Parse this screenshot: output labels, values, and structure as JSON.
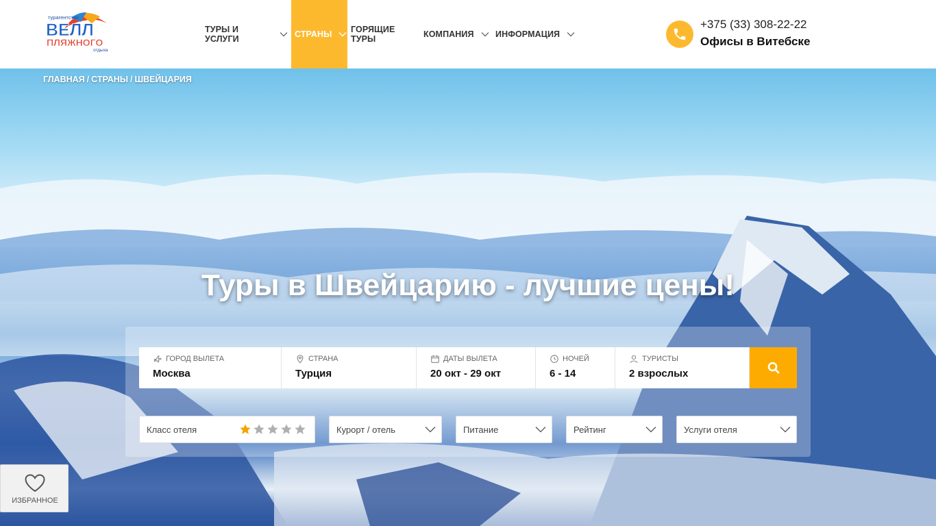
{
  "header": {
    "logo": {
      "small": "турагентство",
      "main_top": "ВЕЛЛ",
      "main_bottom": "ПЛЯЖНОГО",
      "bottom": "отдыха"
    },
    "nav": [
      {
        "label": "Туры и услуги",
        "has_dropdown": true,
        "active": false
      },
      {
        "label": "Страны",
        "has_dropdown": true,
        "active": true
      },
      {
        "label": "Горящие туры",
        "has_dropdown": false,
        "active": false
      },
      {
        "label": "Компания",
        "has_dropdown": true,
        "active": false
      },
      {
        "label": "Информация",
        "has_dropdown": true,
        "active": false
      }
    ],
    "phone": "+375 (33) 308-22-22",
    "offices": "Офисы в Витебске"
  },
  "breadcrumb": [
    "Главная",
    "Страны",
    "Швейцария"
  ],
  "hero": {
    "title": "Туры в Швейцарию - лучшие цены!"
  },
  "search": {
    "fields": [
      {
        "label": "Город вылета",
        "value": "Москва",
        "icon": "plane-icon"
      },
      {
        "label": "Страна",
        "value": "Турция",
        "icon": "map-pin-icon"
      },
      {
        "label": "Даты вылета",
        "value": "20 окт - 29 окт",
        "icon": "calendar-icon"
      },
      {
        "label": "Ночей",
        "value": "6 - 14",
        "icon": "clock-icon"
      },
      {
        "label": "Туристы",
        "value": "2 взрослых",
        "icon": "user-icon"
      }
    ],
    "filters": {
      "hotel_class": "Класс отеля",
      "resort": "Курорт / отель",
      "meal": "Питание",
      "rating": "Рейтинг",
      "services": "Услуги отеля"
    },
    "stars_total": 5,
    "stars_selected": 1
  },
  "favorites": {
    "label": "Избранное"
  },
  "colors": {
    "accent": "#fdb92e",
    "search_button": "#fdab00",
    "star_active": "#f5a300",
    "star_inactive": "#b0b0b0"
  }
}
